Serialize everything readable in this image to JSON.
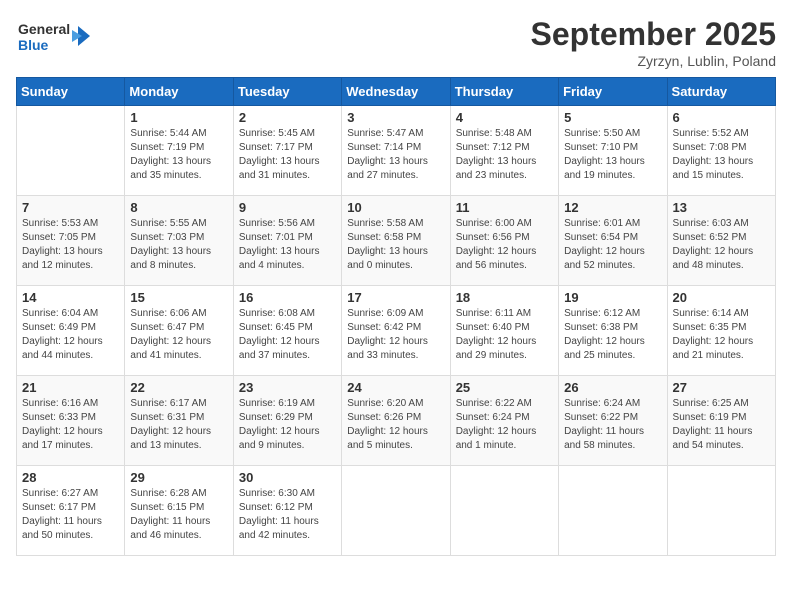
{
  "header": {
    "logo_line1": "General",
    "logo_line2": "Blue",
    "month": "September 2025",
    "location": "Zyrzyn, Lublin, Poland"
  },
  "weekdays": [
    "Sunday",
    "Monday",
    "Tuesday",
    "Wednesday",
    "Thursday",
    "Friday",
    "Saturday"
  ],
  "weeks": [
    [
      {
        "day": "",
        "sunrise": "",
        "sunset": "",
        "daylight": ""
      },
      {
        "day": "1",
        "sunrise": "Sunrise: 5:44 AM",
        "sunset": "Sunset: 7:19 PM",
        "daylight": "Daylight: 13 hours and 35 minutes."
      },
      {
        "day": "2",
        "sunrise": "Sunrise: 5:45 AM",
        "sunset": "Sunset: 7:17 PM",
        "daylight": "Daylight: 13 hours and 31 minutes."
      },
      {
        "day": "3",
        "sunrise": "Sunrise: 5:47 AM",
        "sunset": "Sunset: 7:14 PM",
        "daylight": "Daylight: 13 hours and 27 minutes."
      },
      {
        "day": "4",
        "sunrise": "Sunrise: 5:48 AM",
        "sunset": "Sunset: 7:12 PM",
        "daylight": "Daylight: 13 hours and 23 minutes."
      },
      {
        "day": "5",
        "sunrise": "Sunrise: 5:50 AM",
        "sunset": "Sunset: 7:10 PM",
        "daylight": "Daylight: 13 hours and 19 minutes."
      },
      {
        "day": "6",
        "sunrise": "Sunrise: 5:52 AM",
        "sunset": "Sunset: 7:08 PM",
        "daylight": "Daylight: 13 hours and 15 minutes."
      }
    ],
    [
      {
        "day": "7",
        "sunrise": "Sunrise: 5:53 AM",
        "sunset": "Sunset: 7:05 PM",
        "daylight": "Daylight: 13 hours and 12 minutes."
      },
      {
        "day": "8",
        "sunrise": "Sunrise: 5:55 AM",
        "sunset": "Sunset: 7:03 PM",
        "daylight": "Daylight: 13 hours and 8 minutes."
      },
      {
        "day": "9",
        "sunrise": "Sunrise: 5:56 AM",
        "sunset": "Sunset: 7:01 PM",
        "daylight": "Daylight: 13 hours and 4 minutes."
      },
      {
        "day": "10",
        "sunrise": "Sunrise: 5:58 AM",
        "sunset": "Sunset: 6:58 PM",
        "daylight": "Daylight: 13 hours and 0 minutes."
      },
      {
        "day": "11",
        "sunrise": "Sunrise: 6:00 AM",
        "sunset": "Sunset: 6:56 PM",
        "daylight": "Daylight: 12 hours and 56 minutes."
      },
      {
        "day": "12",
        "sunrise": "Sunrise: 6:01 AM",
        "sunset": "Sunset: 6:54 PM",
        "daylight": "Daylight: 12 hours and 52 minutes."
      },
      {
        "day": "13",
        "sunrise": "Sunrise: 6:03 AM",
        "sunset": "Sunset: 6:52 PM",
        "daylight": "Daylight: 12 hours and 48 minutes."
      }
    ],
    [
      {
        "day": "14",
        "sunrise": "Sunrise: 6:04 AM",
        "sunset": "Sunset: 6:49 PM",
        "daylight": "Daylight: 12 hours and 44 minutes."
      },
      {
        "day": "15",
        "sunrise": "Sunrise: 6:06 AM",
        "sunset": "Sunset: 6:47 PM",
        "daylight": "Daylight: 12 hours and 41 minutes."
      },
      {
        "day": "16",
        "sunrise": "Sunrise: 6:08 AM",
        "sunset": "Sunset: 6:45 PM",
        "daylight": "Daylight: 12 hours and 37 minutes."
      },
      {
        "day": "17",
        "sunrise": "Sunrise: 6:09 AM",
        "sunset": "Sunset: 6:42 PM",
        "daylight": "Daylight: 12 hours and 33 minutes."
      },
      {
        "day": "18",
        "sunrise": "Sunrise: 6:11 AM",
        "sunset": "Sunset: 6:40 PM",
        "daylight": "Daylight: 12 hours and 29 minutes."
      },
      {
        "day": "19",
        "sunrise": "Sunrise: 6:12 AM",
        "sunset": "Sunset: 6:38 PM",
        "daylight": "Daylight: 12 hours and 25 minutes."
      },
      {
        "day": "20",
        "sunrise": "Sunrise: 6:14 AM",
        "sunset": "Sunset: 6:35 PM",
        "daylight": "Daylight: 12 hours and 21 minutes."
      }
    ],
    [
      {
        "day": "21",
        "sunrise": "Sunrise: 6:16 AM",
        "sunset": "Sunset: 6:33 PM",
        "daylight": "Daylight: 12 hours and 17 minutes."
      },
      {
        "day": "22",
        "sunrise": "Sunrise: 6:17 AM",
        "sunset": "Sunset: 6:31 PM",
        "daylight": "Daylight: 12 hours and 13 minutes."
      },
      {
        "day": "23",
        "sunrise": "Sunrise: 6:19 AM",
        "sunset": "Sunset: 6:29 PM",
        "daylight": "Daylight: 12 hours and 9 minutes."
      },
      {
        "day": "24",
        "sunrise": "Sunrise: 6:20 AM",
        "sunset": "Sunset: 6:26 PM",
        "daylight": "Daylight: 12 hours and 5 minutes."
      },
      {
        "day": "25",
        "sunrise": "Sunrise: 6:22 AM",
        "sunset": "Sunset: 6:24 PM",
        "daylight": "Daylight: 12 hours and 1 minute."
      },
      {
        "day": "26",
        "sunrise": "Sunrise: 6:24 AM",
        "sunset": "Sunset: 6:22 PM",
        "daylight": "Daylight: 11 hours and 58 minutes."
      },
      {
        "day": "27",
        "sunrise": "Sunrise: 6:25 AM",
        "sunset": "Sunset: 6:19 PM",
        "daylight": "Daylight: 11 hours and 54 minutes."
      }
    ],
    [
      {
        "day": "28",
        "sunrise": "Sunrise: 6:27 AM",
        "sunset": "Sunset: 6:17 PM",
        "daylight": "Daylight: 11 hours and 50 minutes."
      },
      {
        "day": "29",
        "sunrise": "Sunrise: 6:28 AM",
        "sunset": "Sunset: 6:15 PM",
        "daylight": "Daylight: 11 hours and 46 minutes."
      },
      {
        "day": "30",
        "sunrise": "Sunrise: 6:30 AM",
        "sunset": "Sunset: 6:12 PM",
        "daylight": "Daylight: 11 hours and 42 minutes."
      },
      {
        "day": "",
        "sunrise": "",
        "sunset": "",
        "daylight": ""
      },
      {
        "day": "",
        "sunrise": "",
        "sunset": "",
        "daylight": ""
      },
      {
        "day": "",
        "sunrise": "",
        "sunset": "",
        "daylight": ""
      },
      {
        "day": "",
        "sunrise": "",
        "sunset": "",
        "daylight": ""
      }
    ]
  ]
}
